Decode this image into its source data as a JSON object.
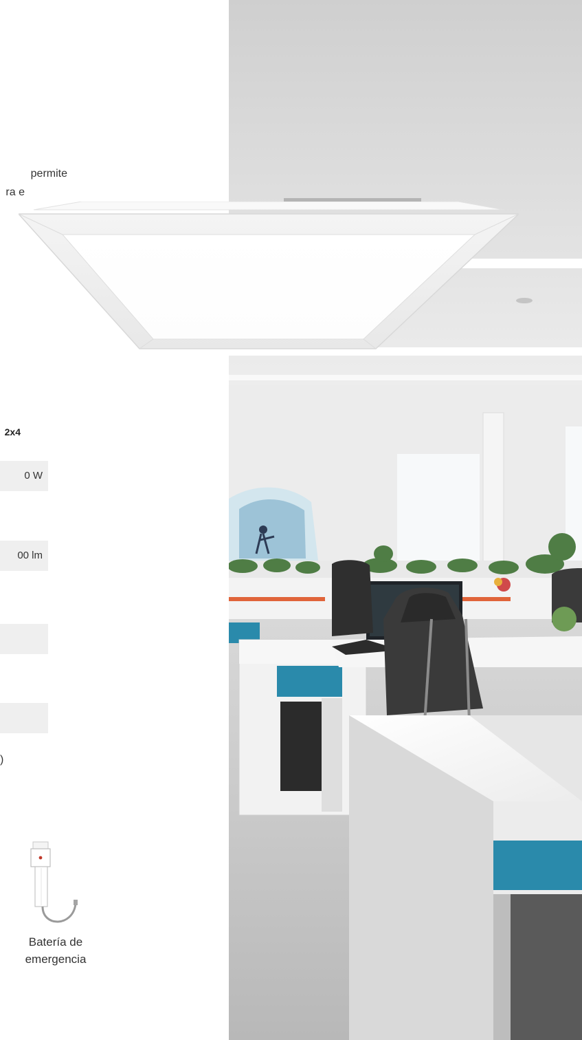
{
  "intro_text": {
    "line1": "permite",
    "line2": "ra e"
  },
  "spec_table": {
    "column_header": "2x4",
    "values": [
      "0 W",
      "00 lm",
      "",
      ""
    ],
    "trailing_text": ")"
  },
  "accessory": {
    "icon": "emergency-battery-icon",
    "label_line1": "Batería de",
    "label_line2": "emergencia"
  },
  "colors": {
    "table_fill": "#efefef",
    "desk_accent": "#2a8aab",
    "chair_trim": "#e0643a"
  }
}
